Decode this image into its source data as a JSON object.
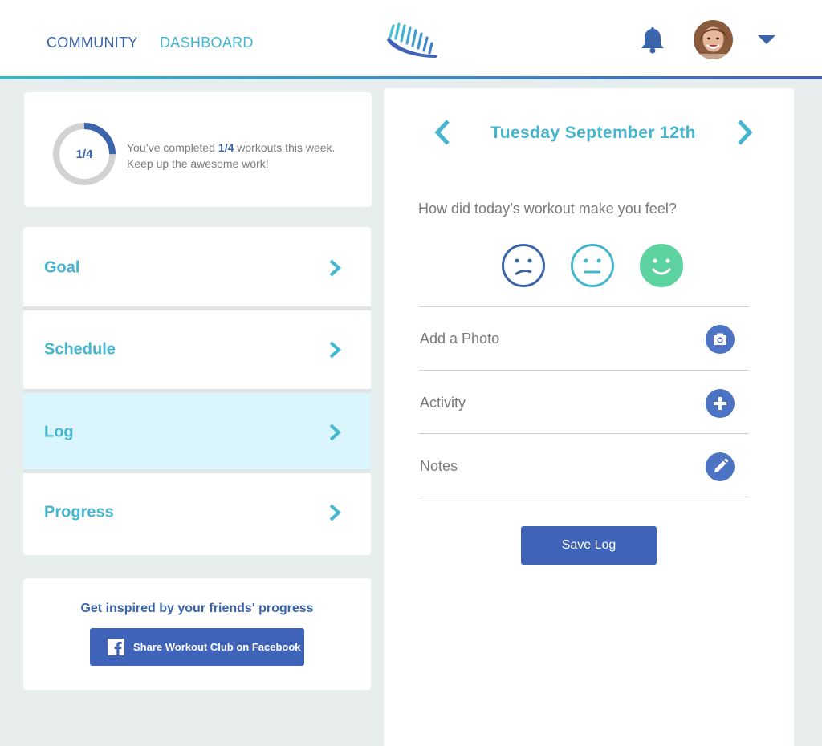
{
  "header": {
    "nav": {
      "community": "COMMUNITY",
      "dashboard": "DASHBOARD"
    }
  },
  "weekly_progress": {
    "ring_label": "1/4",
    "completed": 1,
    "goal": 4,
    "text_prefix": "You’ve completed ",
    "text_value": "1/4",
    "text_suffix": " workouts this week.",
    "text_line2": "Keep up the awesome work!"
  },
  "menu": {
    "items": [
      {
        "label": "Goal"
      },
      {
        "label": "Schedule"
      },
      {
        "label": "Log"
      },
      {
        "label": "Progress"
      }
    ],
    "active": "Log"
  },
  "share": {
    "title": "Get inspired by your friends' progress",
    "button_label": "Share Workout Club on Facebook"
  },
  "log": {
    "date": "Tuesday September 12th",
    "question": "How did today’s workout make you feel?",
    "rows": [
      {
        "label": "Add a Photo",
        "icon": "camera-icon"
      },
      {
        "label": "Activity",
        "icon": "plus-icon"
      },
      {
        "label": "Notes",
        "icon": "pencil-icon"
      }
    ],
    "save_label": "Save Log"
  },
  "colors": {
    "brand_blue": "#3a64ac",
    "accent_teal": "#45b6cf",
    "button_blue": "#3f63b8",
    "active_bg": "#daf5fb",
    "happy_green": "#5dd3a0"
  }
}
